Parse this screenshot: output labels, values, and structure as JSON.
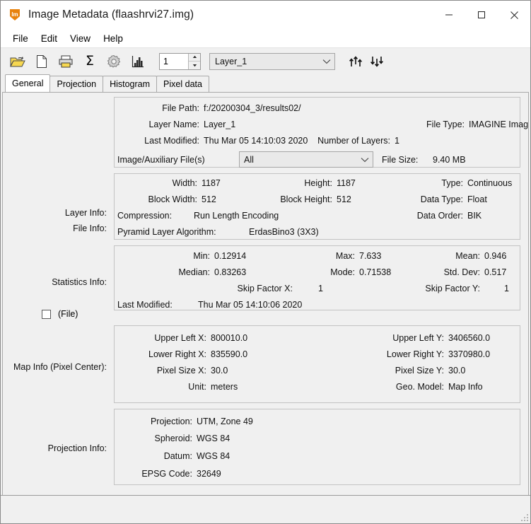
{
  "window": {
    "title": "Image Metadata (flaashrvi27.img)",
    "icon_name": "imagine-app-icon",
    "icon_text": "Im",
    "minimize_label": "Minimize",
    "maximize_label": "Maximize",
    "close_label": "Close"
  },
  "menubar": {
    "items": [
      {
        "label": "File"
      },
      {
        "label": "Edit"
      },
      {
        "label": "View"
      },
      {
        "label": "Help"
      }
    ]
  },
  "toolbar": {
    "icons": [
      {
        "name": "open-folder-icon",
        "title": "Open"
      },
      {
        "name": "new-file-icon",
        "title": "New"
      },
      {
        "name": "print-icon",
        "title": "Print"
      },
      {
        "name": "sigma-icon",
        "title": "Statistics",
        "glyph": "Σ"
      },
      {
        "name": "gear-icon",
        "title": "Settings"
      },
      {
        "name": "histogram-icon",
        "title": "Histogram"
      }
    ],
    "layer_spinner_value": "1",
    "layer_combo_value": "Layer_1",
    "move_up_icon": "arrows-up-icon",
    "move_down_icon": "arrows-down-icon"
  },
  "tabs": [
    {
      "label": "General",
      "active": true
    },
    {
      "label": "Projection",
      "active": false
    },
    {
      "label": "Histogram",
      "active": false
    },
    {
      "label": "Pixel data",
      "active": false
    }
  ],
  "sections": {
    "file_info": {
      "side_label": "File Info:",
      "file_path_label": "File Path:",
      "file_path_value": "f:/20200304_3/results02/",
      "layer_name_label": "Layer Name:",
      "layer_name_value": "Layer_1",
      "file_type_label": "File Type:",
      "file_type_value": "IMAGINE Image",
      "last_modified_label": "Last Modified:",
      "last_modified_value": "Thu Mar 05 14:10:03 2020",
      "number_of_layers_label": "Number of Layers:",
      "number_of_layers_value": "1",
      "aux_files_label": "Image/Auxiliary File(s)",
      "aux_files_value": "All",
      "file_size_label": "File Size:",
      "file_size_value": "9.40 MB"
    },
    "layer_info": {
      "side_label": "Layer Info:",
      "width_label": "Width:",
      "width_value": "1187",
      "height_label": "Height:",
      "height_value": "1187",
      "type_label": "Type:",
      "type_value": "Continuous",
      "block_width_label": "Block Width:",
      "block_width_value": "512",
      "block_height_label": "Block Height:",
      "block_height_value": "512",
      "data_type_label": "Data Type:",
      "data_type_value": "Float",
      "compression_label": "Compression:",
      "compression_value": "Run Length Encoding",
      "data_order_label": "Data Order:",
      "data_order_value": "BIK",
      "pyramid_label": "Pyramid Layer Algorithm:",
      "pyramid_value": "ErdasBino3 (3X3)"
    },
    "statistics_info": {
      "side_label": "Statistics Info:",
      "file_checkbox_label": "(File)",
      "file_checkbox_checked": false,
      "min_label": "Min:",
      "min_value": "0.12914",
      "max_label": "Max:",
      "max_value": "7.633",
      "mean_label": "Mean:",
      "mean_value": "0.946",
      "median_label": "Median:",
      "median_value": "0.83263",
      "mode_label": "Mode:",
      "mode_value": "0.71538",
      "std_dev_label": "Std. Dev:",
      "std_dev_value": "0.517",
      "skip_x_label": "Skip Factor X:",
      "skip_x_value": "1",
      "skip_y_label": "Skip Factor Y:",
      "skip_y_value": "1",
      "last_modified_label": "Last Modified:",
      "last_modified_value": "Thu Mar 05 14:10:06 2020"
    },
    "map_info": {
      "side_label": "Map Info (Pixel Center):",
      "ulx_label": "Upper Left X:",
      "ulx_value": "800010.0",
      "uly_label": "Upper Left Y:",
      "uly_value": "3406560.0",
      "lrx_label": "Lower Right X:",
      "lrx_value": "835590.0",
      "lry_label": "Lower Right Y:",
      "lry_value": "3370980.0",
      "psx_label": "Pixel Size X:",
      "psx_value": "30.0",
      "psy_label": "Pixel Size Y:",
      "psy_value": "30.0",
      "unit_label": "Unit:",
      "unit_value": "meters",
      "geo_model_label": "Geo. Model:",
      "geo_model_value": "Map Info"
    },
    "projection_info": {
      "side_label": "Projection Info:",
      "projection_label": "Projection:",
      "projection_value": "UTM, Zone 49",
      "spheroid_label": "Spheroid:",
      "spheroid_value": "WGS 84",
      "datum_label": "Datum:",
      "datum_value": "WGS 84",
      "epsg_label": "EPSG Code:",
      "epsg_value": "32649"
    }
  },
  "colors": {
    "window_bg": "#f0f0f0",
    "titlebar_bg": "#ffffff",
    "accent": "#e8820c",
    "group_border": "#c3c3c3",
    "text": "#111111"
  }
}
